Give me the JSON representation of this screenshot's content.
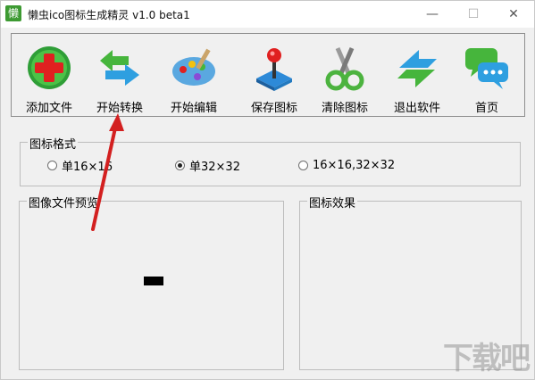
{
  "window": {
    "app_icon_text": "懒",
    "title": "懒虫ico图标生成精灵 v1.0 beta1",
    "minimize_glyph": "—",
    "maximize_glyph": "☐",
    "close_glyph": "✕"
  },
  "toolbar": {
    "buttons": [
      {
        "label": "添加文件",
        "icon": "add-red-cross-icon"
      },
      {
        "label": "开始转换",
        "icon": "convert-arrows-icon"
      },
      {
        "label": "开始编辑",
        "icon": "palette-icon"
      },
      {
        "label": "保存图标",
        "icon": "joystick-icon"
      },
      {
        "label": "清除图标",
        "icon": "scissors-icon"
      },
      {
        "label": "退出软件",
        "icon": "exit-arrow-icon"
      },
      {
        "label": "首页",
        "icon": "chat-bubbles-icon"
      }
    ]
  },
  "format_group": {
    "legend": "图标格式",
    "options": [
      {
        "label": "单16×16",
        "selected": false
      },
      {
        "label": "单32×32",
        "selected": true
      },
      {
        "label": "16×16,32×32",
        "selected": false
      }
    ]
  },
  "preview_group": {
    "legend": "图像文件预览"
  },
  "effect_group": {
    "legend": "图标效果"
  },
  "watermark": "下载吧",
  "colors": {
    "accent_red": "#e02020",
    "accent_green": "#3d9a32",
    "accent_blue": "#1e90d6"
  }
}
